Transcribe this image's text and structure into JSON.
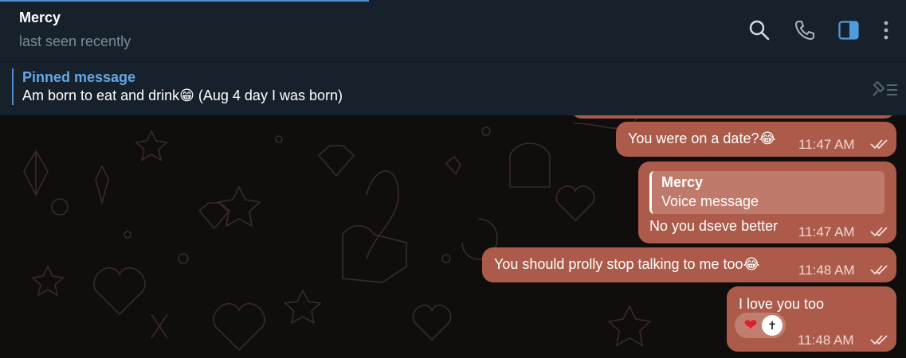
{
  "header": {
    "contact_name": "Mercy",
    "status": "last seen recently",
    "icons": [
      "search-icon",
      "phone-icon",
      "sidebar-toggle-icon",
      "more-vertical-icon"
    ]
  },
  "pinned": {
    "title": "Pinned message",
    "text": "Am born to eat and drink",
    "emoji": "😁",
    "text_after": " (Aug 4 day I was born)",
    "icon": "pinned-list-icon"
  },
  "messages": [
    {
      "text": "You were on a date?",
      "emoji": "😂",
      "time": "11:47 AM",
      "status": "read"
    },
    {
      "reply_to": {
        "name": "Mercy",
        "text": "Voice message"
      },
      "text": "No you dseve better",
      "time": "11:47 AM",
      "status": "read"
    },
    {
      "text": "You should prolly stop talking to me too",
      "emoji": "😂",
      "time": "11:48 AM",
      "status": "read"
    },
    {
      "text": "I love you too",
      "time": "11:48 AM",
      "status": "read",
      "reactions": {
        "emoji": "❤",
        "avatar_glyph": "✝"
      }
    }
  ],
  "colors": {
    "header_bg": "#17212b",
    "accent": "#4f8fcf",
    "outgoing_bubble": "#ac5b4b",
    "chat_pattern": "#3a2a24"
  }
}
